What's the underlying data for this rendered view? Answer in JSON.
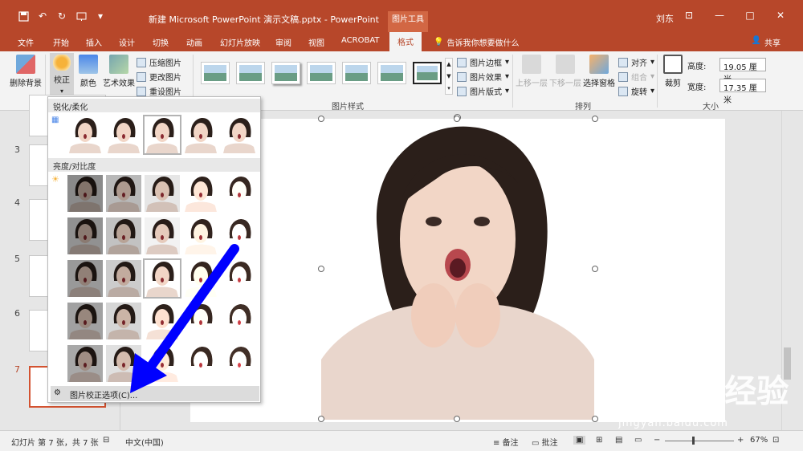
{
  "window": {
    "title": "新建 Microsoft PowerPoint 演示文稿.pptx - PowerPoint",
    "context_tab_header": "图片工具",
    "user": "刘东",
    "minimize": "—",
    "restore": "□",
    "close": "✕"
  },
  "qat": {
    "save_icon": "save-icon",
    "undo": "↶",
    "redo": "↻",
    "customize": "▾"
  },
  "tabs": [
    "文件",
    "开始",
    "插入",
    "设计",
    "切换",
    "动画",
    "幻灯片放映",
    "审阅",
    "视图",
    "ACROBAT",
    "格式"
  ],
  "active_tab": "格式",
  "tell_me": "告诉我你想要做什么",
  "share": "共享",
  "ribbon": {
    "remove_bg": "删除背景",
    "correction": "校正",
    "color": "颜色",
    "art_effects": "艺术效果",
    "compress": "压缩图片",
    "change_pic": "更改图片",
    "reset_pic": "重设图片",
    "picture_styles_label": "图片样式",
    "border": "图片边框",
    "effects": "图片效果",
    "layout": "图片版式",
    "bring_forward": "上移一层",
    "send_backward": "下移一层",
    "selection_pane": "选择窗格",
    "align": "对齐",
    "group": "组合",
    "rotate": "旋转",
    "arrange_label": "排列",
    "crop": "裁剪",
    "height_label": "高度:",
    "height_value": "19.05 厘米",
    "width_label": "宽度:",
    "width_value": "17.35 厘米",
    "size_label": "大小"
  },
  "dropdown": {
    "sharpen_header": "锐化/柔化",
    "brightness_header": "亮度/对比度",
    "footer": "图片校正选项(C)..."
  },
  "slides": {
    "numbers": [
      "3",
      "4",
      "5",
      "6",
      "7"
    ],
    "active": "7"
  },
  "statusbar": {
    "slide_info": "幻灯片 第 7 张，共 7 张",
    "language": "中文(中国)",
    "notes": "备注",
    "comments": "批注",
    "zoom": "67%"
  },
  "watermark": {
    "brand": "Baidu 经验",
    "url": "jingyan.baidu.com"
  },
  "colors": {
    "accent": "#b7472a",
    "arrow": "#0000ff"
  }
}
